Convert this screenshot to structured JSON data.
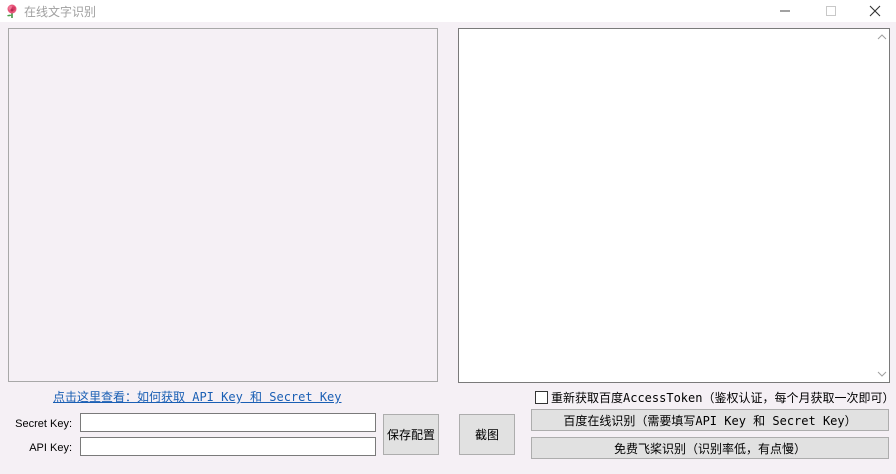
{
  "window": {
    "title": "在线文字识别",
    "icon": "rose-icon"
  },
  "help_link": "点击这里查看：如何获取 API Key 和 Secret Key",
  "fields": {
    "secret_key_label": "Secret Key:",
    "api_key_label": "API Key:",
    "secret_key_value": "",
    "api_key_value": ""
  },
  "buttons": {
    "save": "保存配置",
    "screenshot": "截图",
    "baidu": "百度在线识别（需要填写API Key 和 Secret Key）",
    "free": "免费飞桨识别（识别率低，有点慢）"
  },
  "checkbox": {
    "label": "重新获取百度AccessToken（鉴权认证，每个月获取一次即可）",
    "checked": false
  }
}
